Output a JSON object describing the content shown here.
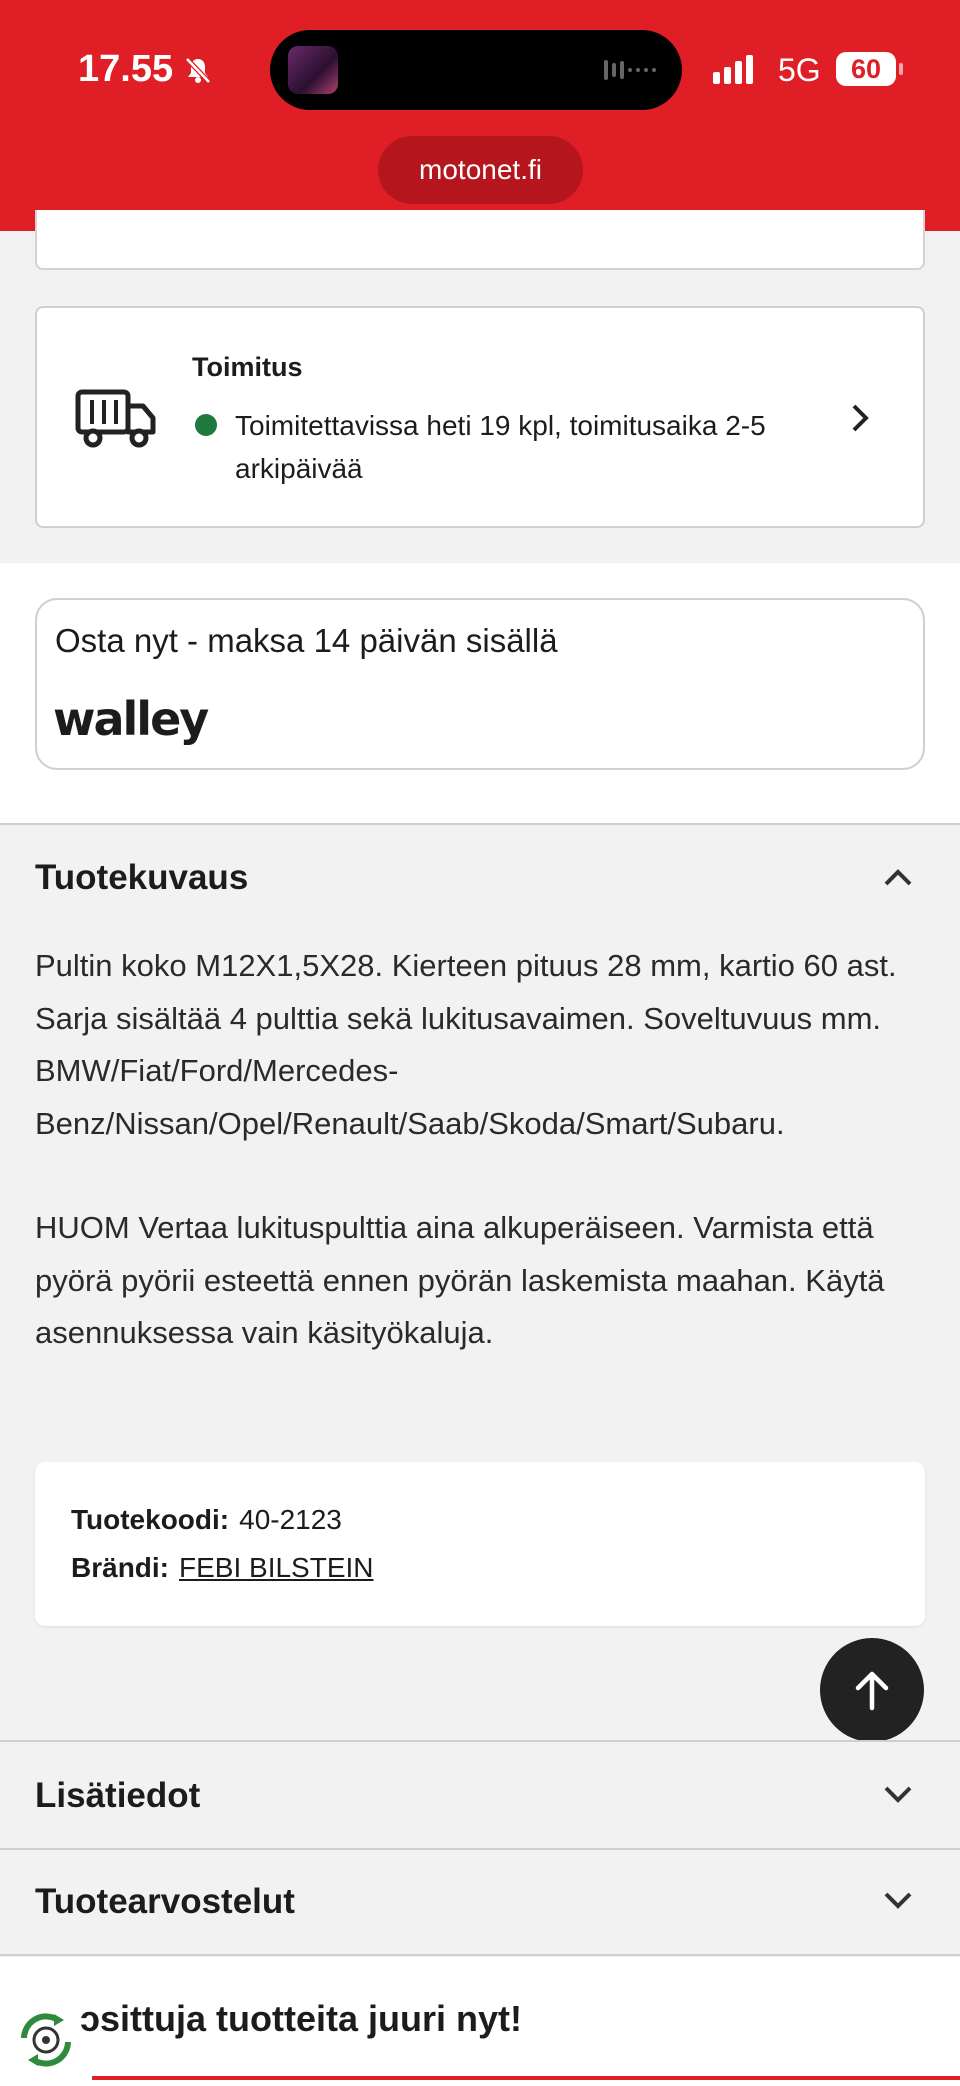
{
  "status_bar": {
    "time": "17.55",
    "network": "5G",
    "battery": "60"
  },
  "browser": {
    "url": "motonet.fi"
  },
  "delivery": {
    "title": "Toimitus",
    "status_text": "Toimitettavissa heti 19 kpl, toimitusaika 2-5 arkipäivää",
    "status_color": "#1e7a3d"
  },
  "walley": {
    "title": "Osta nyt - maksa 14 päivän sisällä",
    "logo_text": "walley"
  },
  "description": {
    "heading": "Tuotekuvaus",
    "paragraphs": [
      "Pultin koko M12X1,5X28. Kierteen pituus 28 mm, kartio 60 ast. Sarja sisältää 4 pulttia sekä lukitusavaimen. Soveltuvuus mm. BMW/Fiat/Ford/Mercedes-Benz/Nissan/Opel/Renault/Saab/Skoda/Smart/Subaru.",
      "HUOM Vertaa lukituspulttia aina alkuperäiseen. Varmista että pyörä pyörii esteettä ennen pyörän laskemista maahan. Käytä asennuksessa vain käsityökaluja."
    ]
  },
  "product_info": {
    "code_label": "Tuotekoodi:",
    "code_value": "40-2123",
    "brand_label": "Brändi:",
    "brand_value": "FEBI BILSTEIN"
  },
  "sections": {
    "more_info": "Lisätiedot",
    "reviews": "Tuotearvostelut"
  },
  "promo": {
    "text": "ɔsittuja tuotteita juuri nyt!"
  },
  "colors": {
    "brand_red": "#e01e26",
    "fab": "#222222"
  }
}
